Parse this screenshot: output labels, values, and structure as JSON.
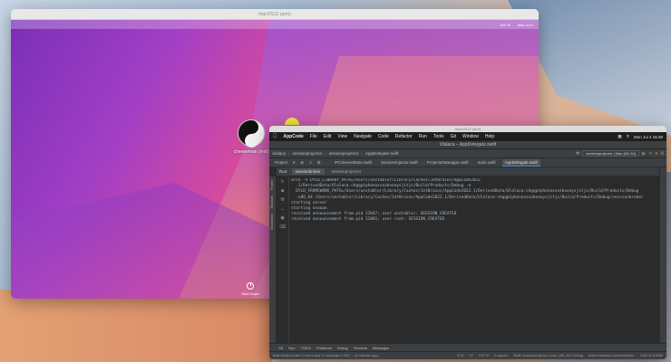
{
  "vm_window": {
    "title": "macOS12 (arm)",
    "menubar_right": [
      "100 %",
      "Mon Jul 4"
    ]
  },
  "desktop": {
    "icon_label": "cheeseman (test)",
    "shutdown_label": "Shut Down"
  },
  "ide_vm_title": "macOS12 (arm)",
  "mac_menubar": {
    "app": "AppCode",
    "items": [
      "File",
      "Edit",
      "View",
      "Navigate",
      "Code",
      "Refactor",
      "Run",
      "Tools",
      "Git",
      "Window",
      "Help"
    ],
    "datetime": "Mon Jul 4  15:30"
  },
  "ide": {
    "window_title": "Ulalaca – AppDelegate.swift",
    "breadcrumbs": [
      "Ulalaca",
      "sessionprojector",
      "sessionprojector",
      "AppDelegate.swift"
    ],
    "run_config": "sessionprojector | Mac (M1 64)",
    "project_label": "Project",
    "editor_tabs": [
      "IPCServerBase.swift",
      "SessionInjector.swift",
      "ProjectorManager.swift",
      "main.swift",
      "AppDelegate.swift"
    ],
    "active_editor_tab": "AppDelegate.swift",
    "run_label": "Run:",
    "run_tabs": [
      "sessionbroker",
      "sessionprojector"
    ],
    "console_lines": [
      "arch -e DYLD_LIBRARY_PATH=/Users/unstabler/Library/Caches/JetBrains/AppCode2022",
      "  .1/DerivedData/Ulalaca-chgqptphenoxsezbvonysjitjs/Build/Products/Debug -e",
      "  DYLD_FRAMEWORK_PATH=/Users/unstabler/Library/Caches/JetBrains/AppCode2022.1/DerivedData/Ulalaca-chgqptphenoxsezbvonysjitjs/Build/Products/Debug",
      "  -x86_64 /Users/unstabler/Library/Caches/JetBrains/AppCode2022.1/DerivedData/Ulalaca-chgqptphenoxsezbvonysjitjs/Build/Products/Debug/sessionbroker",
      "starting server",
      "starting xsoaan",
      "received announcement from pid 12047; user unstabler: SESSION_CREATED",
      "received announcement from pid 12081; user root: SESSION_CREATED"
    ],
    "left_strip": [
      "Project",
      "Structure",
      "Bookmarks"
    ],
    "bottom_tools": [
      "Git",
      "Run",
      "TODO",
      "Problems",
      "Debug",
      "Terminal",
      "Messages"
    ],
    "status": {
      "message": "Build finished with 0 errors and 17 warnings in 657 ... (4 minutes ago)",
      "position": "4:70",
      "line_sep": "LF",
      "encoding": "UTF-8",
      "indent": "4 spaces",
      "context": "Swift: sessionprojector | mac_x86_64 | Debug",
      "branch": "feature/session-sessionbroker",
      "memory": "1403 of 4096M"
    }
  }
}
